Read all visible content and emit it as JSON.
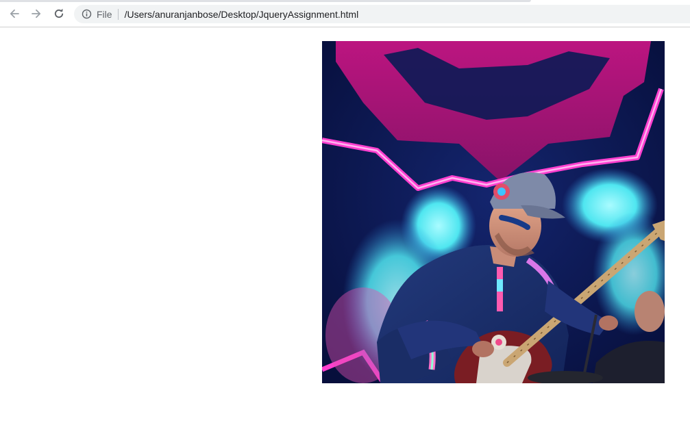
{
  "browser": {
    "nav": {
      "back_icon": "arrow-left-icon",
      "forward_icon": "arrow-right-icon",
      "reload_icon": "reload-icon"
    },
    "omnibox": {
      "info_icon": "info-circle-icon",
      "scheme_label": "File",
      "url": "/Users/anuranjanbose/Desktop/JqueryAssignment.html"
    }
  },
  "page": {
    "image": {
      "description_icon": "concert-photo-guitarist",
      "colors": {
        "background": "#0a1a5c",
        "neon_pink": "#ff1fb4",
        "magenta": "#b0186e",
        "cyan": "#4fe6f0",
        "shirt": "#1c2f6a"
      }
    }
  }
}
